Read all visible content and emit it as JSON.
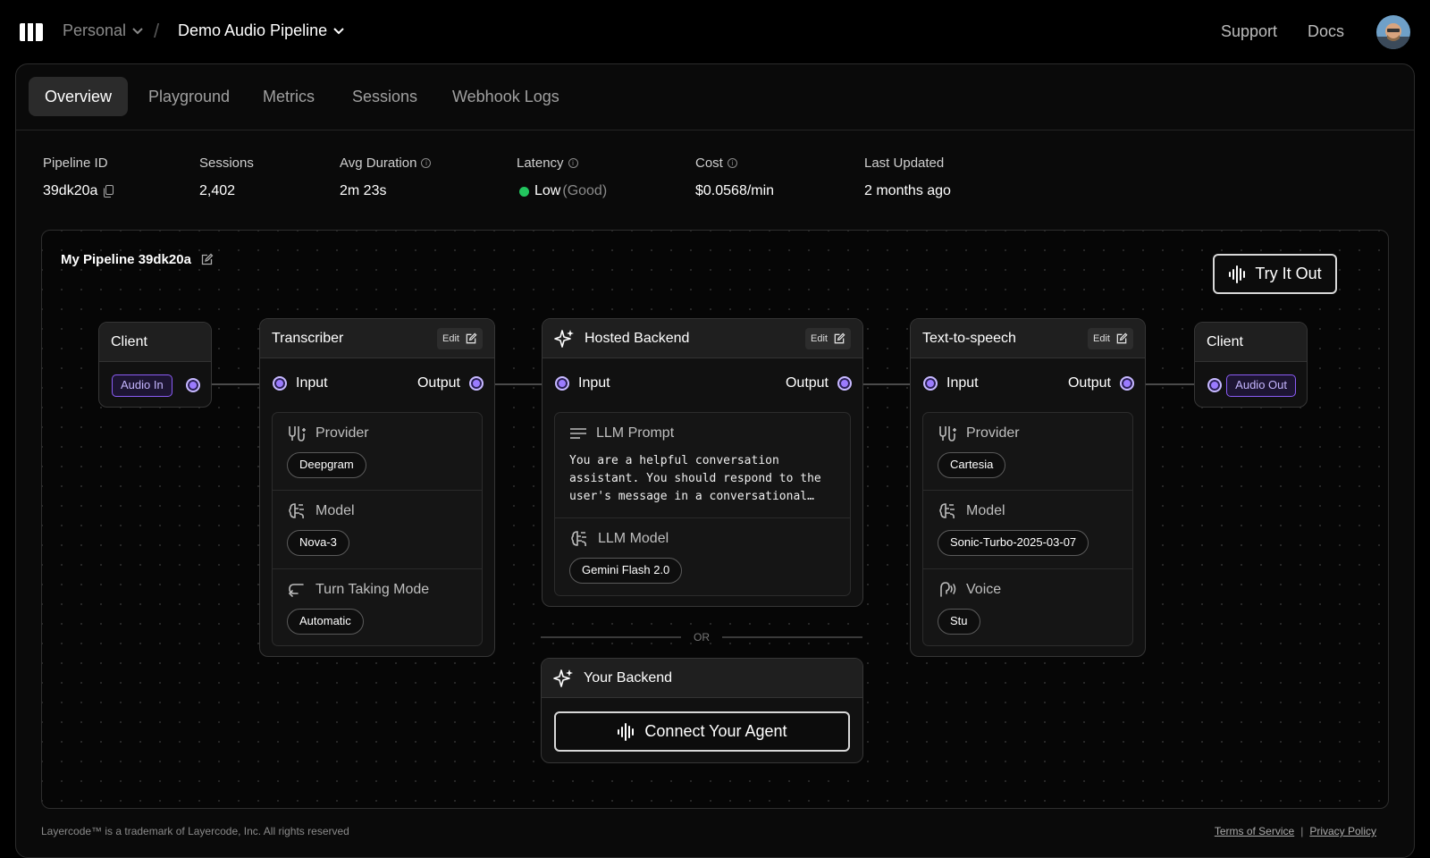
{
  "header": {
    "workspace": "Personal",
    "project": "Demo Audio Pipeline",
    "support": "Support",
    "docs": "Docs"
  },
  "tabs": [
    {
      "label": "Overview",
      "active": true
    },
    {
      "label": "Playground",
      "active": false
    },
    {
      "label": "Metrics",
      "active": false
    },
    {
      "label": "Sessions",
      "active": false
    },
    {
      "label": "Webhook Logs",
      "active": false
    }
  ],
  "stats": {
    "pipeline_id": {
      "label": "Pipeline ID",
      "value": "39dk20a"
    },
    "sessions": {
      "label": "Sessions",
      "value": "2,402"
    },
    "avg_duration": {
      "label": "Avg Duration",
      "value": "2m 23s"
    },
    "latency": {
      "label": "Latency",
      "value": "Low",
      "note": "(Good)",
      "status_color": "#22c55e"
    },
    "cost": {
      "label": "Cost",
      "value": "$0.0568/min"
    },
    "last_updated": {
      "label": "Last Updated",
      "value": "2 months ago"
    }
  },
  "pipeline": {
    "name": "My Pipeline 39dk20a",
    "try_button": "Try It Out",
    "edit_label": "Edit",
    "input_label": "Input",
    "output_label": "Output",
    "client_in": {
      "title": "Client",
      "tag": "Audio In"
    },
    "client_out": {
      "title": "Client",
      "tag": "Audio Out"
    },
    "transcriber": {
      "title": "Transcriber",
      "provider_label": "Provider",
      "provider": "Deepgram",
      "model_label": "Model",
      "model": "Nova-3",
      "turn_label": "Turn Taking Mode",
      "turn": "Automatic"
    },
    "backend": {
      "title": "Hosted Backend",
      "prompt_label": "LLM Prompt",
      "prompt": "You are a helpful conversation\nassistant. You should respond to the\nuser's message in a conversational…",
      "model_label": "LLM Model",
      "model": "Gemini Flash 2.0"
    },
    "or_label": "OR",
    "your_backend": {
      "title": "Your Backend",
      "connect": "Connect Your Agent"
    },
    "tts": {
      "title": "Text-to-speech",
      "provider_label": "Provider",
      "provider": "Cartesia",
      "model_label": "Model",
      "model": "Sonic-Turbo-2025-03-07",
      "voice_label": "Voice",
      "voice": "Stu"
    }
  },
  "footer": {
    "trademark": "Layercode™ is a trademark of Layercode, Inc. All rights reserved",
    "terms": "Terms of Service",
    "separator": "|",
    "privacy": "Privacy Policy"
  },
  "colors": {
    "accent": "#8b5cf6",
    "status_good": "#22c55e",
    "background": "#000000"
  },
  "icons": [
    "logo-icon",
    "chevron-down-icon",
    "copy-icon",
    "info-icon",
    "pencil-icon",
    "waveform-icon",
    "sparkle-icon",
    "provider-icon",
    "brain-icon",
    "turn-icon",
    "lines-icon",
    "voice-icon"
  ]
}
